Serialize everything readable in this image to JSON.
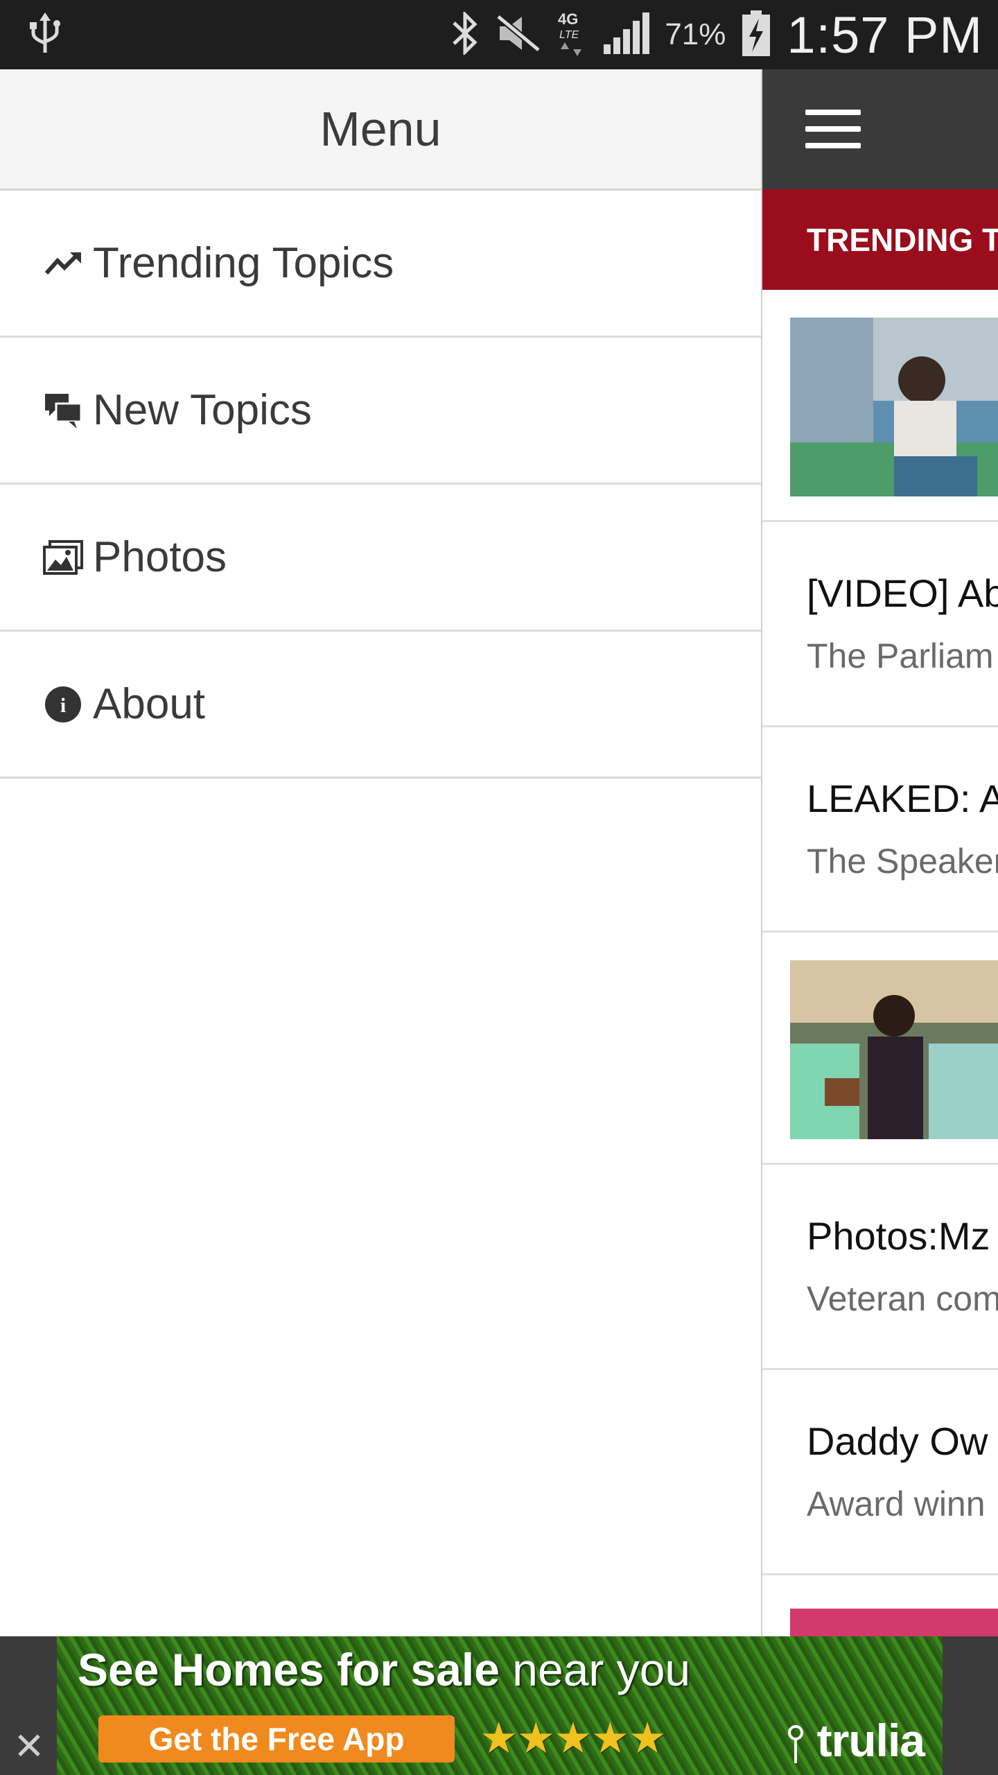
{
  "status_bar": {
    "battery_percent": "71%",
    "time": "1:57 PM",
    "icons": [
      "usb-icon",
      "bluetooth-icon",
      "mute-icon",
      "lte-4g-icon",
      "signal-icon",
      "battery-charging-icon"
    ]
  },
  "drawer": {
    "title": "Menu",
    "items": [
      {
        "label": "Trending Topics",
        "icon": "trending-icon"
      },
      {
        "label": "New Topics",
        "icon": "chat-bubbles-icon"
      },
      {
        "label": "Photos",
        "icon": "photos-icon"
      },
      {
        "label": "About",
        "icon": "info-icon"
      }
    ]
  },
  "content": {
    "section_title": "TRENDING T",
    "cards": [
      {
        "type": "image"
      },
      {
        "type": "text",
        "headline": "[VIDEO] Ab",
        "snippet": "The Parliam"
      },
      {
        "type": "text",
        "headline": "LEAKED: A",
        "snippet": "The Speaker"
      },
      {
        "type": "image"
      },
      {
        "type": "text",
        "headline": "Photos:Mz",
        "snippet": "Veteran com"
      },
      {
        "type": "text",
        "headline": "Daddy Ow",
        "snippet": "Award winn"
      }
    ]
  },
  "ad": {
    "headline_bold": "See Homes for sale",
    "headline_light": "near you",
    "cta": "Get the Free App",
    "stars": "★★★★★",
    "brand": "trulia",
    "close": "✕"
  },
  "colors": {
    "accent_red": "#9a0d1c",
    "topbar": "#3a3a3a",
    "cta_orange": "#f08a1e"
  }
}
